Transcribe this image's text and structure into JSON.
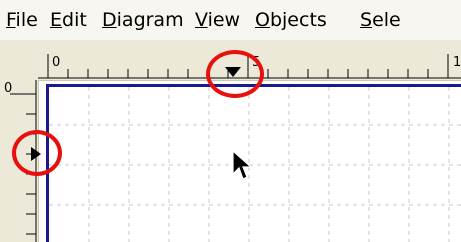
{
  "menu": {
    "items": [
      {
        "id": "file",
        "label": "File"
      },
      {
        "id": "edit",
        "label": "Edit"
      },
      {
        "id": "diagram",
        "label": "Diagram"
      },
      {
        "id": "view",
        "label": "View"
      },
      {
        "id": "objects",
        "label": "Objects"
      },
      {
        "id": "select",
        "label": "Sele"
      }
    ]
  },
  "rulers": {
    "horizontal_labels": [
      "0",
      "5",
      "1"
    ],
    "vertical_labels": [
      "0"
    ]
  },
  "colors": {
    "highlight_circle": "#e8100c",
    "canvas_border": "#1a1a8c",
    "grid": "#c8c8c8",
    "ruler_bg": "#ece9d8"
  },
  "icons": {
    "horizontal_marker": "triangle-down-icon",
    "vertical_marker": "triangle-right-icon",
    "cursor": "arrow-cursor-icon"
  }
}
